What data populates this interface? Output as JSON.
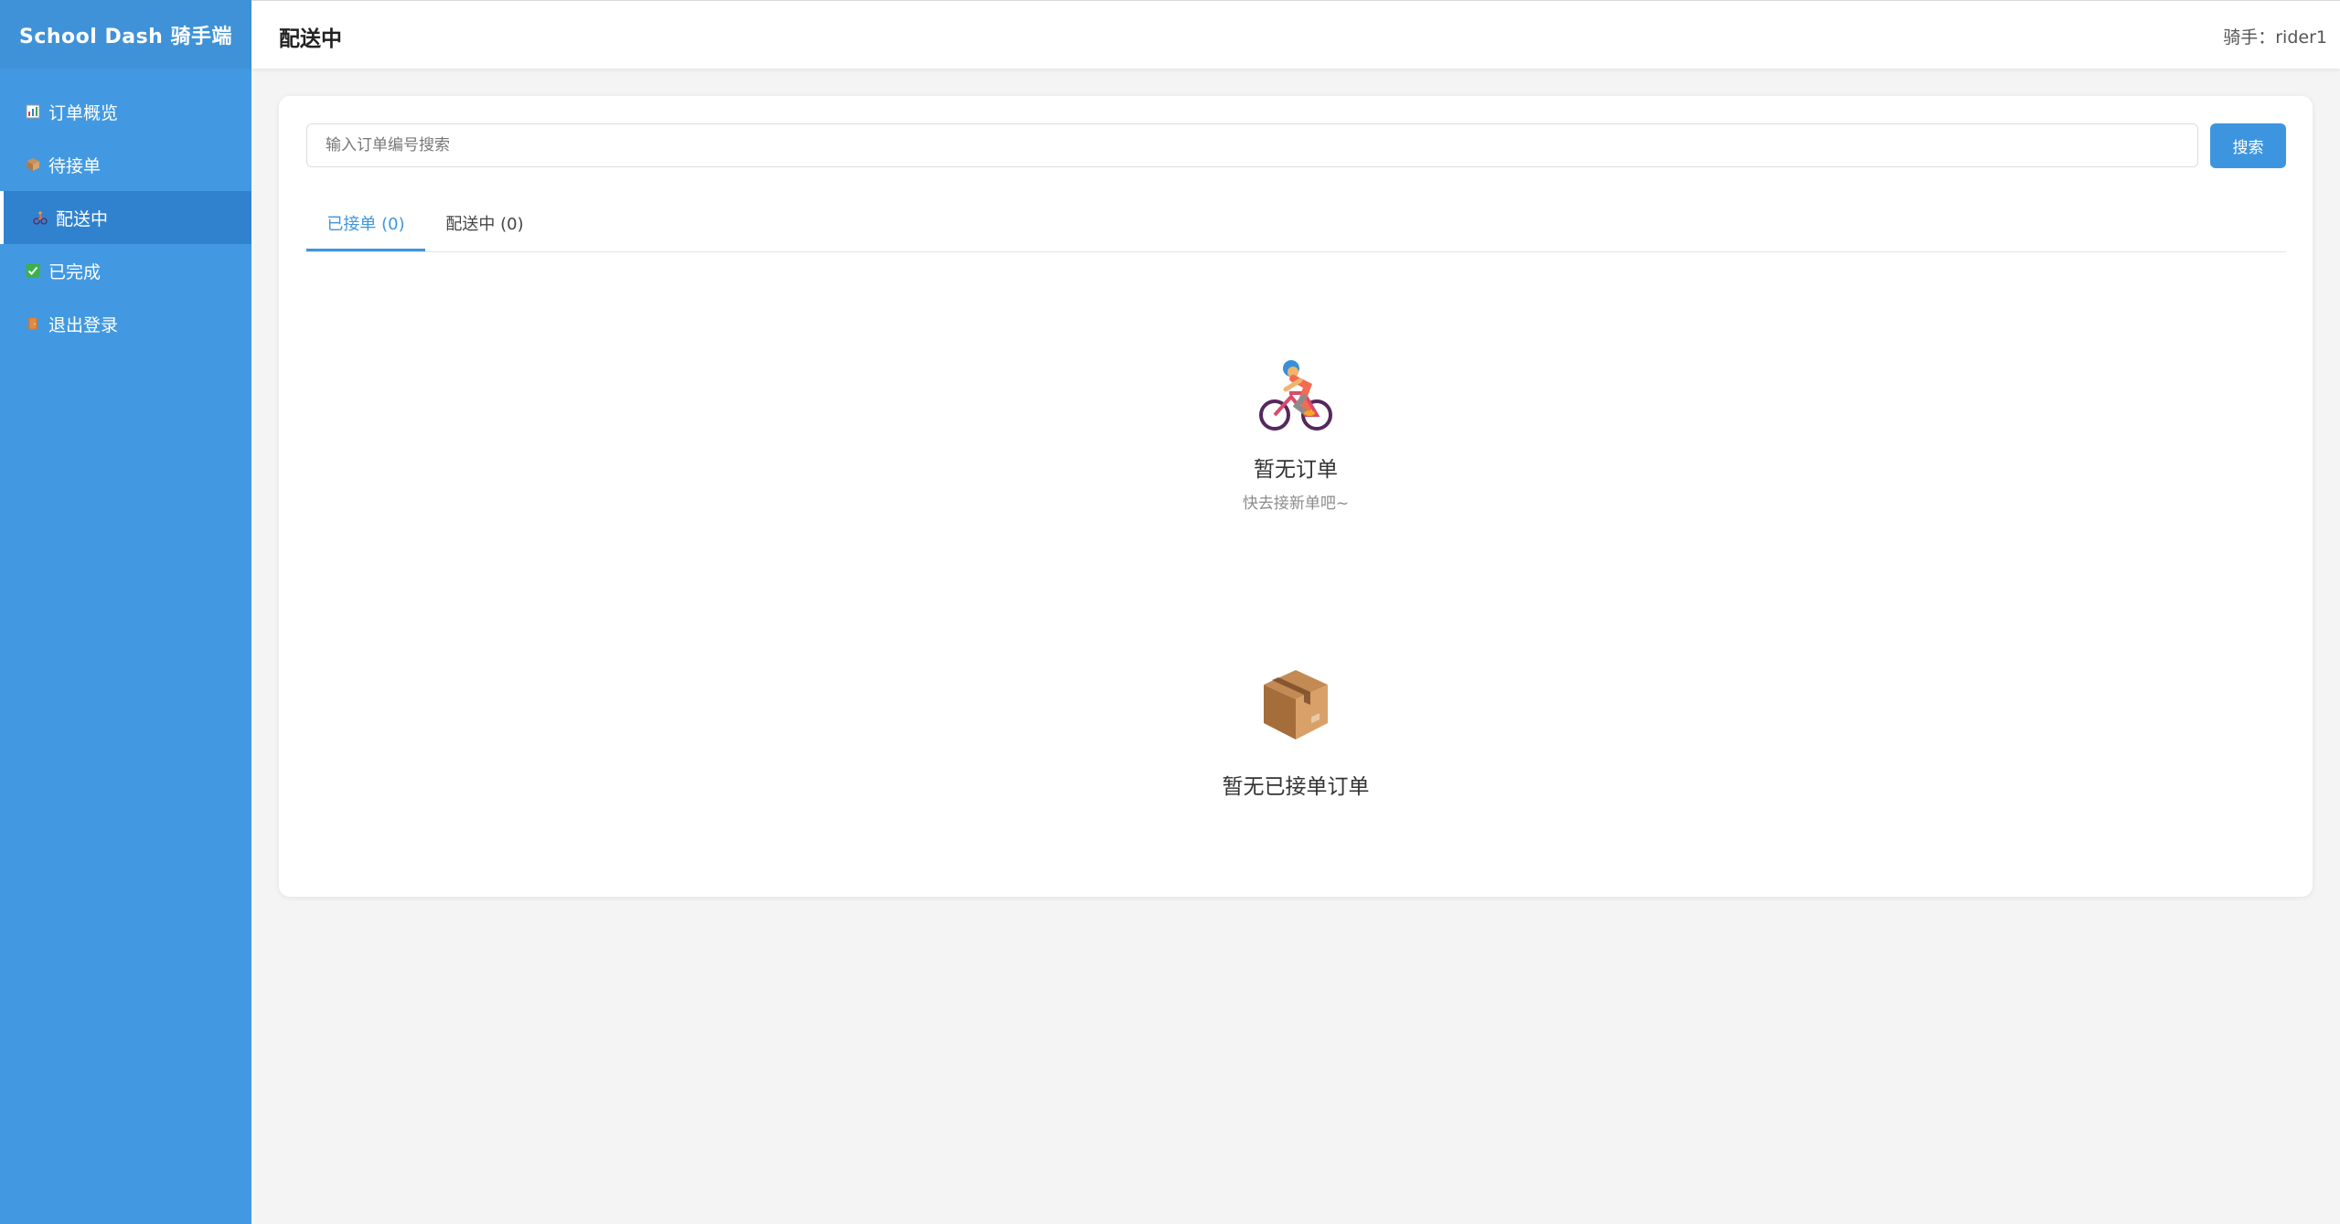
{
  "sidebar": {
    "brand": "School Dash 骑手端",
    "items": [
      {
        "label": "订单概览",
        "icon": "chart-icon"
      },
      {
        "label": "待接单",
        "icon": "package-icon"
      },
      {
        "label": "配送中",
        "icon": "cyclist-icon",
        "active": true
      },
      {
        "label": "已完成",
        "icon": "check-icon"
      },
      {
        "label": "退出登录",
        "icon": "door-icon"
      }
    ]
  },
  "header": {
    "title": "配送中",
    "rider": "骑手：rider1"
  },
  "search": {
    "placeholder": "输入订单编号搜索",
    "value": "",
    "button_label": "搜索"
  },
  "tabs": [
    {
      "label": "已接单 (0)",
      "active": true
    },
    {
      "label": "配送中 (0)",
      "active": false
    }
  ],
  "empty_states": [
    {
      "icon": "cyclist-icon",
      "title": "暂无订单",
      "subtitle": "快去接新单吧~"
    },
    {
      "icon": "package-icon",
      "title": "暂无已接单订单"
    }
  ],
  "colors": {
    "sidebar_bg": "#4299e1",
    "sidebar_active": "#3182ce",
    "accent": "#3e95df",
    "page_bg": "#f4f4f4"
  }
}
